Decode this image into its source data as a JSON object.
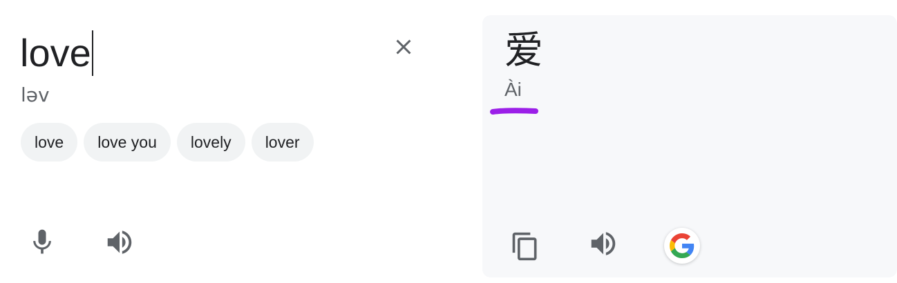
{
  "source": {
    "text": "love",
    "phonetic": "ləv",
    "clear_icon": "close-icon",
    "suggestions": [
      "love",
      "love you",
      "lovely",
      "lover"
    ],
    "mic_icon": "microphone-icon",
    "speaker_icon": "speaker-icon"
  },
  "target": {
    "text": "爱",
    "romanization": "Ài",
    "copy_icon": "copy-icon",
    "speaker_icon": "speaker-icon",
    "google_icon": "google-g-icon"
  },
  "colors": {
    "text_primary": "#202124",
    "text_secondary": "#5f6368",
    "icon_gray": "#5f6368",
    "chip_background": "#f1f3f4",
    "target_panel_background": "#f7f8fa",
    "highlight_stroke": "#9b1fe8",
    "google_blue": "#4285F4",
    "google_red": "#EA4335",
    "google_yellow": "#FBBC05",
    "google_green": "#34A853"
  }
}
